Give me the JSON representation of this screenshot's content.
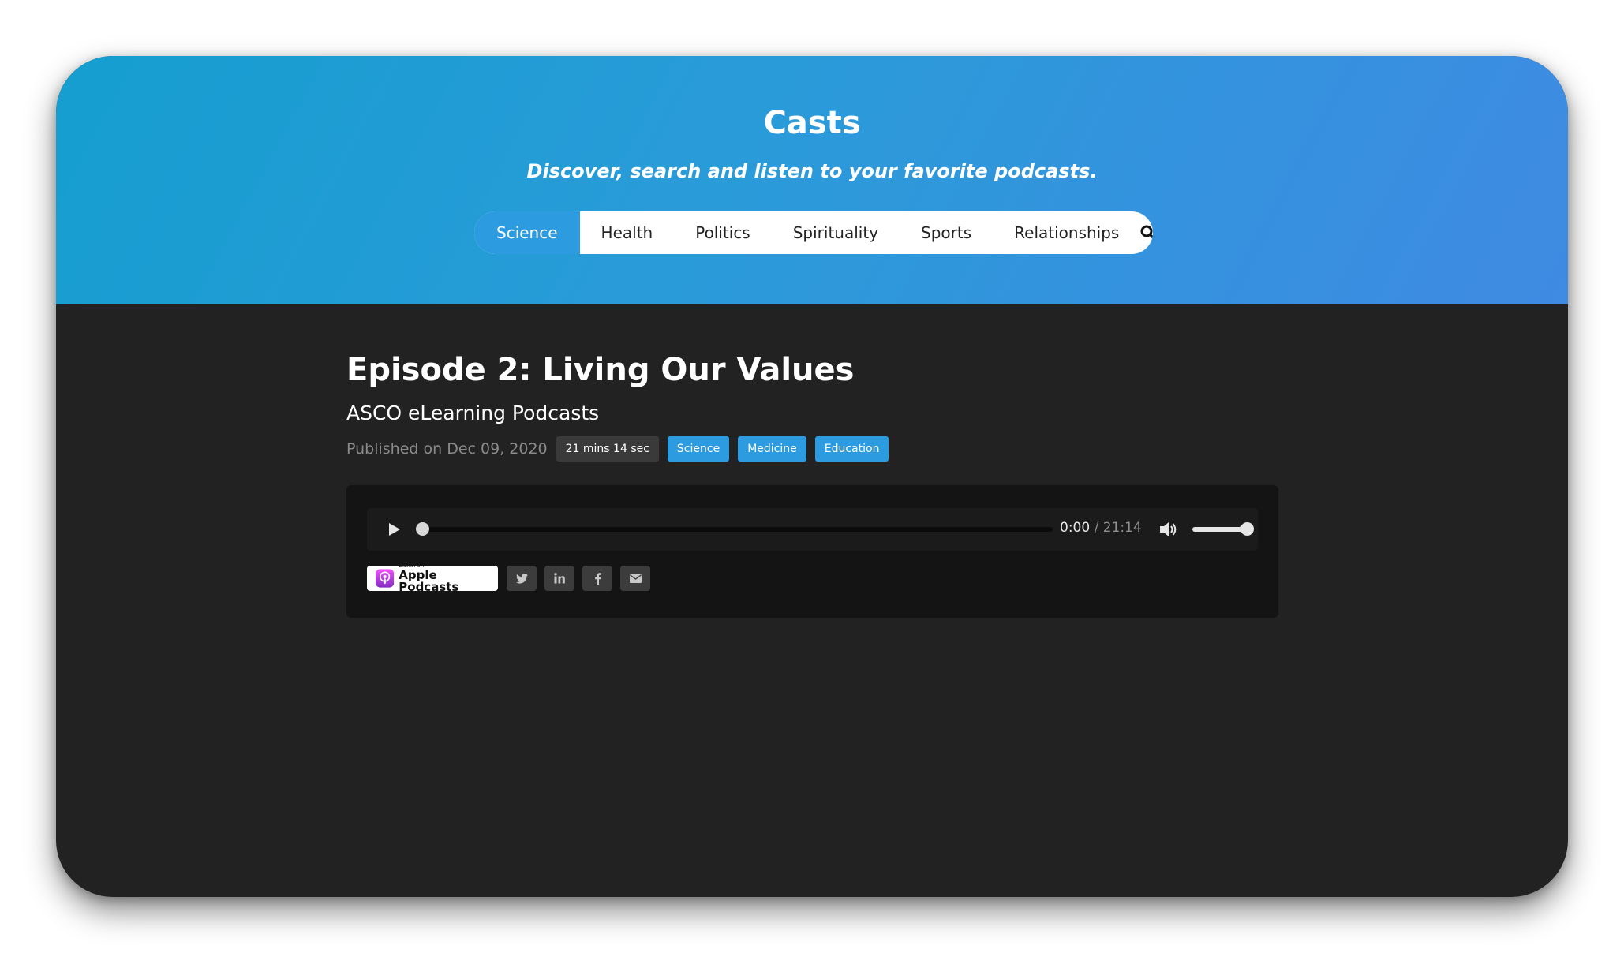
{
  "header": {
    "title": "Casts",
    "subtitle": "Discover, search and listen to your favorite podcasts."
  },
  "nav": {
    "items": [
      {
        "label": "Science",
        "active": true
      },
      {
        "label": "Health"
      },
      {
        "label": "Politics"
      },
      {
        "label": "Spirituality"
      },
      {
        "label": "Sports"
      },
      {
        "label": "Relationships"
      }
    ],
    "search_icon": "search-icon"
  },
  "episode": {
    "title": "Episode 2: Living Our Values",
    "show": "ASCO eLearning Podcasts",
    "published": "Published on Dec 09, 2020",
    "duration": "21 mins 14 sec",
    "tags": [
      "Science",
      "Medicine",
      "Education"
    ]
  },
  "player": {
    "current_time": "0:00",
    "separator": "/",
    "total_time": "21:14",
    "progress_fraction": 0,
    "volume_fraction": 1
  },
  "share": {
    "apple_badge": {
      "small": "Listen on",
      "big": "Apple Podcasts"
    },
    "buttons": [
      "twitter-icon",
      "linkedin-icon",
      "facebook-icon",
      "email-icon"
    ]
  },
  "colors": {
    "accent": "#2d9be0",
    "background": "#222222",
    "player_background": "#141414"
  }
}
